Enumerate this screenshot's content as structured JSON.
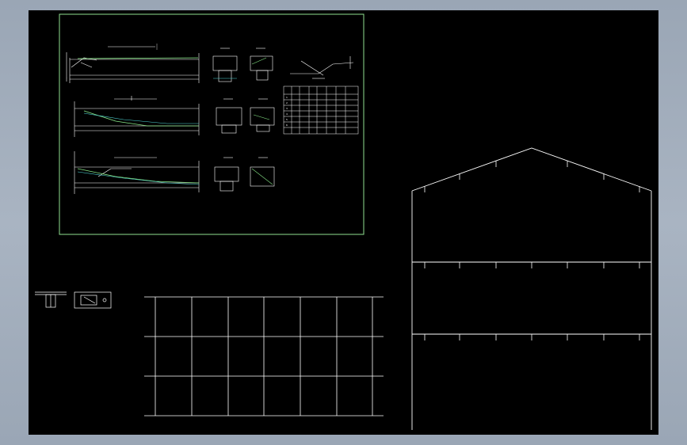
{
  "colors": {
    "app_background": "#a3aebd",
    "canvas_background": "#000000",
    "frame_green": "#90e090",
    "line_white": "#ffffff",
    "beam_cyan": "#50d8d8",
    "steel_green": "#88e888"
  },
  "drawing": {
    "table_header": [
      "",
      "",
      "",
      "",
      "",
      "",
      "",
      ""
    ],
    "table_rows": [
      [
        "1",
        "",
        "",
        "",
        "",
        "",
        "",
        ""
      ],
      [
        "2",
        "",
        "",
        "",
        "",
        "",
        "",
        ""
      ],
      [
        "3",
        "",
        "",
        "",
        "",
        "",
        "",
        ""
      ],
      [
        "4",
        "",
        "",
        "",
        "",
        "",
        "",
        ""
      ],
      [
        "5",
        "",
        "",
        "",
        "",
        "",
        "",
        ""
      ],
      [
        "6",
        "",
        "",
        "",
        "",
        "",
        "",
        ""
      ]
    ]
  }
}
